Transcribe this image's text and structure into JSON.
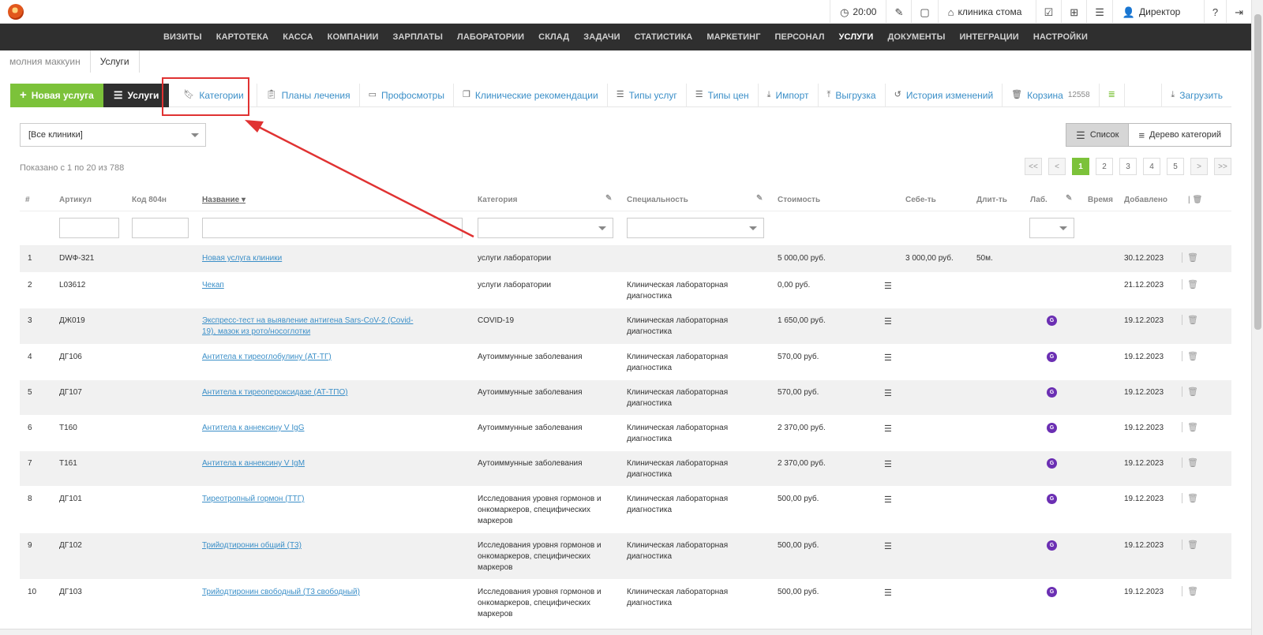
{
  "topbar": {
    "time": "20:00",
    "clinic": "клиника стома",
    "user": "Директор"
  },
  "nav": [
    "ВИЗИТЫ",
    "КАРТОТЕКА",
    "КАССА",
    "КОМПАНИИ",
    "ЗАРПЛАТЫ",
    "ЛАБОРАТОРИИ",
    "СКЛАД",
    "ЗАДАЧИ",
    "СТАТИСТИКА",
    "МАРКЕТИНГ",
    "ПЕРСОНАЛ",
    "УСЛУГИ",
    "ДОКУМЕНТЫ",
    "ИНТЕГРАЦИИ",
    "НАСТРОЙКИ"
  ],
  "nav_active": "УСЛУГИ",
  "breadcrumbs": {
    "prev": "молния маккуин",
    "current": "Услуги"
  },
  "toolbar": {
    "new_service": "Новая услуга",
    "services": "Услуги",
    "categories": "Категории",
    "treatment_plans": "Планы лечения",
    "checkups": "Профосмотры",
    "clinical_recs": "Клинические рекомендации",
    "service_types": "Типы услуг",
    "price_types": "Типы цен",
    "import": "Импорт",
    "export": "Выгрузка",
    "history": "История изменений",
    "trash": "Корзина",
    "trash_count": "12558",
    "download": "Загрузить"
  },
  "filters": {
    "clinic_select": "[Все клиники]",
    "view_list": "Список",
    "view_tree": "Дерево категорий",
    "shown_text": "Показано с 1 по 20 из 788"
  },
  "pager": [
    "<<",
    "<",
    "1",
    "2",
    "3",
    "4",
    "5",
    ">",
    ">>"
  ],
  "pager_current": "1",
  "columns": {
    "num": "#",
    "article": "Артикул",
    "code": "Код 804н",
    "name": "Название",
    "category": "Категория",
    "specialty": "Специальность",
    "cost": "Стоимость",
    "self_cost": "Себе-ть",
    "duration": "Длит-ть",
    "lab": "Лаб.",
    "time": "Время",
    "added": "Добавлено"
  },
  "rows": [
    {
      "n": "1",
      "article": "DWФ-321",
      "name": "Новая услуга клиники",
      "category": "услуги лаборатории",
      "specialty": "",
      "cost": "5 000,00 руб.",
      "self_cost": "3 000,00 руб.",
      "duration": "50м.",
      "lab": false,
      "list": false,
      "added": "30.12.2023"
    },
    {
      "n": "2",
      "article": "L03612",
      "name": "Чекап",
      "category": "услуги лаборатории",
      "specialty": "Клиническая лабораторная диагностика",
      "cost": "0,00 руб.",
      "self_cost": "",
      "duration": "",
      "lab": false,
      "list": true,
      "added": "21.12.2023"
    },
    {
      "n": "3",
      "article": "ДЖ019",
      "name": "Экспресс-тест на выявление антигена Sars-CoV-2 (Covid-19), мазок из рото/носоглотки",
      "category": "COVID-19",
      "specialty": "Клиническая лабораторная диагностика",
      "cost": "1 650,00 руб.",
      "self_cost": "",
      "duration": "",
      "lab": true,
      "list": true,
      "added": "19.12.2023"
    },
    {
      "n": "4",
      "article": "ДГ106",
      "name": "Антитела к тиреоглобулину (АТ-ТГ)",
      "category": "Аутоиммунные заболевания",
      "specialty": "Клиническая лабораторная диагностика",
      "cost": "570,00 руб.",
      "self_cost": "",
      "duration": "",
      "lab": true,
      "list": true,
      "added": "19.12.2023"
    },
    {
      "n": "5",
      "article": "ДГ107",
      "name": "Антитела к тиреопероксидазе (АТ-ТПО)",
      "category": "Аутоиммунные заболевания",
      "specialty": "Клиническая лабораторная диагностика",
      "cost": "570,00 руб.",
      "self_cost": "",
      "duration": "",
      "lab": true,
      "list": true,
      "added": "19.12.2023"
    },
    {
      "n": "6",
      "article": "T160",
      "name": "Антитела к аннексину V IgG",
      "category": "Аутоиммунные заболевания",
      "specialty": "Клиническая лабораторная диагностика",
      "cost": "2 370,00 руб.",
      "self_cost": "",
      "duration": "",
      "lab": true,
      "list": true,
      "added": "19.12.2023"
    },
    {
      "n": "7",
      "article": "T161",
      "name": "Антитела к аннексину V IgM",
      "category": "Аутоиммунные заболевания",
      "specialty": "Клиническая лабораторная диагностика",
      "cost": "2 370,00 руб.",
      "self_cost": "",
      "duration": "",
      "lab": true,
      "list": true,
      "added": "19.12.2023"
    },
    {
      "n": "8",
      "article": "ДГ101",
      "name": "Тиреотропный гормон (ТТГ)",
      "category": "Исследования уровня гормонов и онкомаркеров, специфических маркеров",
      "specialty": "Клиническая лабораторная диагностика",
      "cost": "500,00 руб.",
      "self_cost": "",
      "duration": "",
      "lab": true,
      "list": true,
      "added": "19.12.2023"
    },
    {
      "n": "9",
      "article": "ДГ102",
      "name": "Трийодтиронин общий (Т3)",
      "category": "Исследования уровня гормонов и онкомаркеров, специфических маркеров",
      "specialty": "Клиническая лабораторная диагностика",
      "cost": "500,00 руб.",
      "self_cost": "",
      "duration": "",
      "lab": true,
      "list": true,
      "added": "19.12.2023"
    },
    {
      "n": "10",
      "article": "ДГ103",
      "name": "Трийодтиронин свободный (Т3 свободный)",
      "category": "Исследования уровня гормонов и онкомаркеров, специфических маркеров",
      "specialty": "Клиническая лабораторная диагностика",
      "cost": "500,00 руб.",
      "self_cost": "",
      "duration": "",
      "lab": true,
      "list": true,
      "added": "19.12.2023"
    }
  ],
  "colors": {
    "accent_green": "#7cc23a",
    "nav_dark": "#2f2f2f",
    "link_blue": "#3b8fc8",
    "annotation_red": "#e03232",
    "lab_purple": "#6b2fb3"
  }
}
